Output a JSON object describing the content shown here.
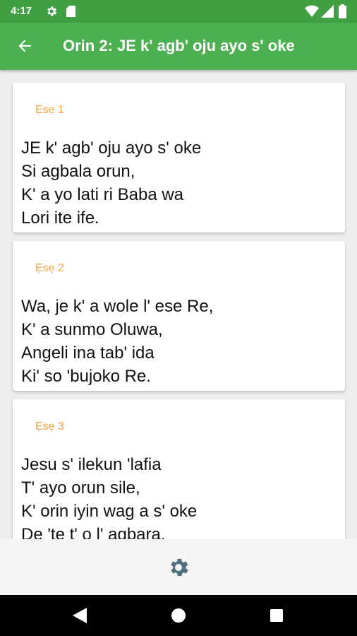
{
  "status_bar": {
    "time": "4:17",
    "icons": [
      "gear-icon",
      "sd-card-icon",
      "wifi-icon",
      "signal-icon",
      "battery-icon"
    ]
  },
  "app_bar": {
    "title": "Orin 2: JE k' agb' oju ayo s' oke",
    "back_icon": "arrow-back-icon"
  },
  "verses": [
    {
      "label": "Ẹsẹ 1",
      "lines": [
        "JE k' agb' oju ayo s' oke",
        "Si agbala orun,",
        "K' a yo lati ri Baba wa",
        "Lori ite ife."
      ]
    },
    {
      "label": "Ẹsẹ 2",
      "lines": [
        "Wa, je k' a wole l' ese Re,",
        "K' a sunmo Oluwa,",
        "Angeli ina tab' ida",
        "Ki' so 'bujoko Re."
      ]
    },
    {
      "label": "Ẹsẹ 3",
      "lines": [
        "Jesu s' ilekun 'lafia",
        "T' ayo orun sile,",
        "K' orin iyin wag a s' oke",
        "De 'te t' o l' agbara."
      ]
    }
  ],
  "bottom_bar": {
    "settings_icon": "settings-icon"
  },
  "colors": {
    "status_bar": "#3f9f42",
    "app_bar": "#4caf50",
    "verse_label": "#f5a342",
    "background": "#eeeeee",
    "settings_icon": "#4f6f7f"
  }
}
